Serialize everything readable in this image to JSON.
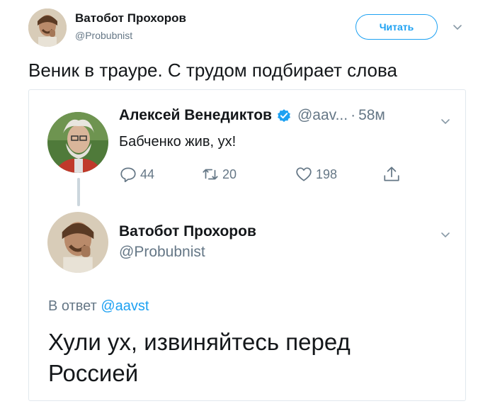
{
  "outer_tweet": {
    "author_name": "Ватобот Прохоров",
    "author_handle": "@Probubnist",
    "follow_label": "Читать",
    "text": "Веник в трауре. С трудом подбирает слова"
  },
  "quoted": {
    "tweet1": {
      "author_name": "Алексей Венедиктов",
      "author_handle": "@aav...",
      "separator": "·",
      "time": "58м",
      "text": "Бабченко жив, ух!",
      "replies": "44",
      "retweets": "20",
      "likes": "198"
    },
    "tweet2": {
      "author_name": "Ватобот Прохоров",
      "author_handle": "@Probubnist",
      "reply_prefix": "В ответ ",
      "reply_handle": "@aavst",
      "text": "Хули ух, извиняйтесь перед Россией"
    }
  },
  "colors": {
    "accent": "#1da1f2",
    "secondary_text": "#657786",
    "border": "#e1e8ed"
  },
  "icons": [
    "chevron-down-icon",
    "verified-badge-icon",
    "reply-icon",
    "retweet-icon",
    "like-icon",
    "share-icon"
  ]
}
